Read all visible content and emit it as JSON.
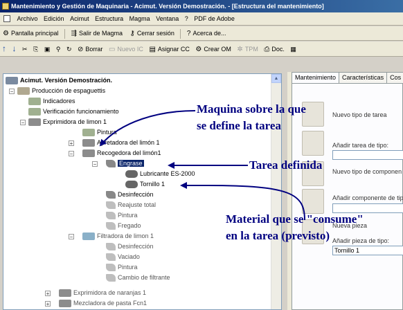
{
  "window": {
    "title": "Mantenimiento y Gestión de Maquinaria - Acimut. Versión Demostración. - [Estructura del mantenimiento]"
  },
  "menu": [
    "Archivo",
    "Edición",
    "Acimut",
    "Estructura",
    "Magma",
    "Ventana",
    "?",
    "PDF de Adobe"
  ],
  "toolbar1": {
    "pantalla": "Pantalla principal",
    "salir": "Salir de Magma",
    "cerrar": "Cerrar sesión",
    "acerca": "Acerca de..."
  },
  "toolbar2": {
    "borrar": "Borrar",
    "nuevo_ic": "Nuevo IC",
    "asignar_cc": "Asignar CC",
    "crear_om": "Crear OM",
    "tpm": "TPM",
    "doc": "Doc."
  },
  "tree": {
    "root": "Acimut. Versión Demostración.",
    "produccion": "Producción de espaguettis",
    "indicadores": "Indicadores",
    "verificacion": "Verificación funcionamiento",
    "exprimidora": "Exprimidora de limon 1",
    "pintura": "Pintura",
    "apretadora": "Apretadora del limón 1",
    "recogedora": "Recogedora del limón1",
    "engrase": "Engrase",
    "lubricante": "Lubricante ES-2000",
    "tornillo": "Tornillo 1",
    "desinfeccion": "Desinfección",
    "reajuste": "Reajuste total",
    "pintura2": "Pintura",
    "fregado": "Fregado",
    "filtradora": "Filtradora de limon 1",
    "desinfeccion2": "Desinfección",
    "vaciado": "Vaciado",
    "pintura3": "Pintura",
    "cambio": "Cambio de filtrante",
    "exprimidora_naranjas": "Exprimidora de naranjas 1",
    "mezcladora": "Mezcladora de pasta Fcn1"
  },
  "tabs": [
    "Mantenimiento",
    "Características",
    "Cos"
  ],
  "right": {
    "nuevo_tipo_tarea": "Nuevo tipo de tarea",
    "anadir_tarea": "Añadir tarea de tipo:",
    "nuevo_tipo_componente": "Nuevo tipo de componen",
    "anadir_componente": "Añadir componente de tip",
    "nueva_pieza": "Nueva pieza",
    "anadir_pieza": "Añadir pieza de tipo:",
    "pieza_value": "Tornillo 1"
  },
  "annotations": {
    "maquina_line1": "Maquina sobre la que",
    "maquina_line2": "se define la tarea",
    "tarea": "Tarea definida",
    "material_line1": "Material que se \"consume\"",
    "material_line2": "en la tarea (previsto)"
  },
  "colors": {
    "title_bar": "#0a246a",
    "selection": "#0a246a",
    "annotation": "#000080"
  }
}
